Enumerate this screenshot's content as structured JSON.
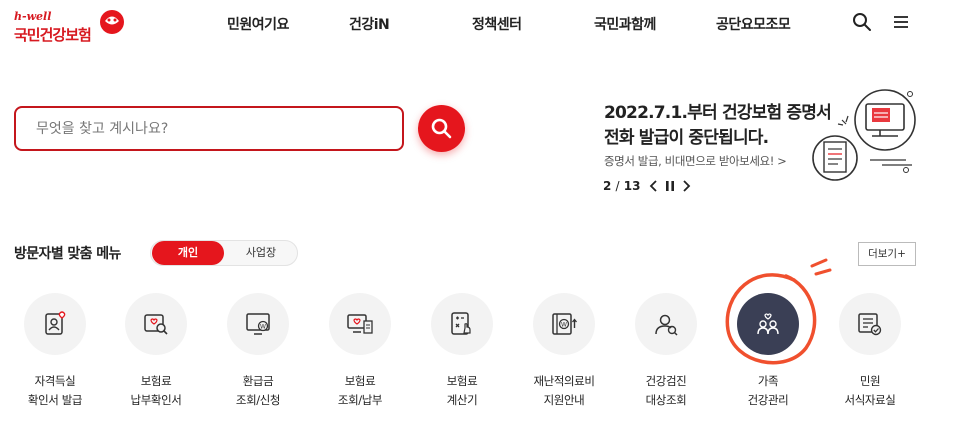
{
  "header": {
    "logo_tagline": "h-well",
    "logo_name": "국민건강보험",
    "nav": [
      "민원여기요",
      "건강iN",
      "정책센터",
      "국민과함께",
      "공단요모조모"
    ],
    "icons": [
      "search-icon",
      "hamburger-menu-icon"
    ]
  },
  "search": {
    "placeholder": "무엇을 찾고 계시나요?",
    "button_icon": "search-icon"
  },
  "banner": {
    "title_line1": "2022.7.1.부터 건강보험 증명서",
    "title_line2": "전화 발급이 중단됩니다.",
    "subtitle": "증명서 발급, 비대면으로 받아보세요! >",
    "page_current": "2",
    "page_sep": "/",
    "page_total": "13"
  },
  "menu": {
    "title": "방문자별 맞춤 메뉴",
    "toggle": [
      "개인",
      "사업장"
    ],
    "more_label": "더보기+",
    "items": [
      {
        "line1": "자격득실",
        "line2": "확인서 발급",
        "icon": "id-card-icon"
      },
      {
        "line1": "보험료",
        "line2": "납부확인서",
        "icon": "document-search-icon"
      },
      {
        "line1": "환급금",
        "line2": "조회/신청",
        "icon": "monitor-refund-icon"
      },
      {
        "line1": "보험료",
        "line2": "조회/납부",
        "icon": "payment-monitor-icon"
      },
      {
        "line1": "보험료",
        "line2": "계산기",
        "icon": "calculator-icon"
      },
      {
        "line1": "재난적의료비",
        "line2": "지원안내",
        "icon": "medical-support-icon"
      },
      {
        "line1": "건강검진",
        "line2": "대상조회",
        "icon": "health-checkup-icon"
      },
      {
        "line1": "가족",
        "line2": "건강관리",
        "icon": "family-health-icon"
      },
      {
        "line1": "민원",
        "line2": "서식자료실",
        "icon": "form-document-icon"
      }
    ]
  },
  "colors": {
    "brand_red": "#e5161d",
    "dark_highlight": "#3a3f55",
    "annotation_orange": "#f0502e"
  }
}
